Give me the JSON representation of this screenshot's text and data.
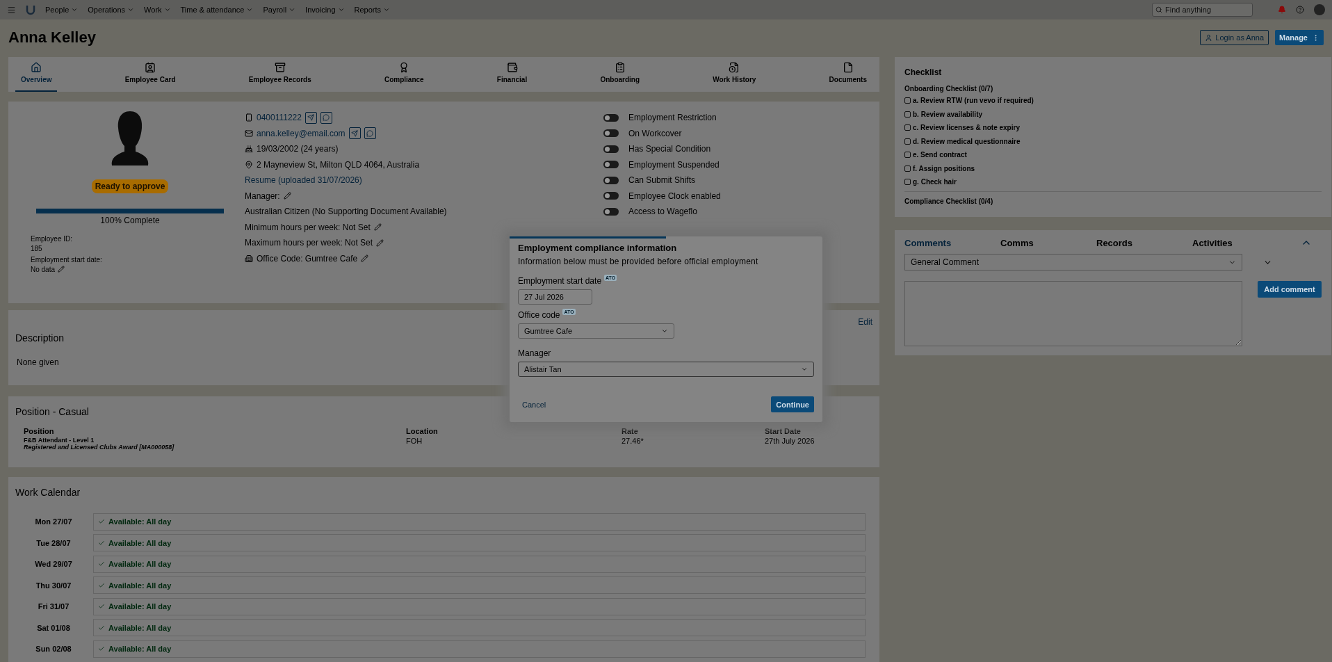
{
  "nav": {
    "items": [
      "People",
      "Operations",
      "Work",
      "Time & attendance",
      "Payroll",
      "Invoicing",
      "Reports"
    ],
    "search_placeholder": "Find anything"
  },
  "header": {
    "title": "Anna Kelley",
    "login_button": "Login as Anna",
    "manage_button": "Manage"
  },
  "tabs": [
    {
      "label": "Overview",
      "selected": true
    },
    {
      "label": "Employee Card",
      "selected": false
    },
    {
      "label": "Employee Records",
      "selected": false
    },
    {
      "label": "Compliance",
      "selected": false
    },
    {
      "label": "Financial",
      "selected": false
    },
    {
      "label": "Onboarding",
      "selected": false
    },
    {
      "label": "Work History",
      "selected": false
    },
    {
      "label": "Documents",
      "selected": false
    }
  ],
  "profile": {
    "status_badge": "Ready to approve",
    "progress": {
      "level": 1
    },
    "progress_label": "100% Complete",
    "fields": [
      {
        "label": "Employee ID:",
        "value": "185",
        "editable": false
      },
      {
        "label": "Employment start date:",
        "value": "No data",
        "editable": true
      }
    ]
  },
  "details": [
    {
      "kind": "phone",
      "text": "0400111222"
    },
    {
      "kind": "email",
      "text": "anna.kelley@email.com"
    },
    {
      "kind": "birthday",
      "text": "19/03/2002 (24 years)"
    },
    {
      "kind": "address",
      "text": "2 Mayneview St, Milton QLD 4064, Australia"
    },
    {
      "kind": "link",
      "text": "Resume (uploaded 31/07/2026)"
    },
    {
      "kind": "editable",
      "text": "Manager:"
    },
    {
      "kind": "plain",
      "text": "Australian Citizen (No Supporting Document Available)"
    },
    {
      "kind": "editable",
      "text": "Minimum hours per week: Not Set"
    },
    {
      "kind": "editable",
      "text": "Maximum hours per week: Not Set"
    },
    {
      "kind": "office",
      "text": "Office Code: Gumtree Cafe"
    }
  ],
  "toggles": [
    {
      "label": "Employment Restriction",
      "on": false
    },
    {
      "label": "On Workcover",
      "on": false
    },
    {
      "label": "Has Special Condition",
      "on": false
    },
    {
      "label": "Employment Suspended",
      "on": false
    },
    {
      "label": "Can Submit Shifts",
      "on": false
    },
    {
      "label": "Employee Clock enabled",
      "on": false
    },
    {
      "label": "Access to Wageflo",
      "on": false
    }
  ],
  "description": {
    "title": "Description",
    "edit": "Edit",
    "text": "None given"
  },
  "position": {
    "title": "Position - Casual",
    "columns": [
      "Position",
      "Location",
      "Rate",
      "Start Date"
    ],
    "row": {
      "position": "F&B Attendant - Level 1",
      "award": "Registered and Licensed Clubs Award [MA000058]",
      "location": "FOH",
      "rate": "27.46*",
      "start_date": "27th July 2026"
    }
  },
  "calendar": {
    "title": "Work Calendar",
    "days": [
      {
        "day": "Mon 27/07",
        "status": "Available: All day"
      },
      {
        "day": "Tue 28/07",
        "status": "Available: All day"
      },
      {
        "day": "Wed 29/07",
        "status": "Available: All day"
      },
      {
        "day": "Thu 30/07",
        "status": "Available: All day"
      },
      {
        "day": "Fri 31/07",
        "status": "Available: All day"
      },
      {
        "day": "Sat 01/08",
        "status": "Available: All day"
      },
      {
        "day": "Sun 02/08",
        "status": "Available: All day"
      }
    ]
  },
  "checklist": {
    "title": "Checklist",
    "onboarding_title": "Onboarding Checklist (0/7)",
    "items": [
      {
        "label": "a. Review RTW (run vevo if required)",
        "checked": false
      },
      {
        "label": "b. Review availability",
        "checked": false
      },
      {
        "label": "c. Review licenses & note expiry",
        "checked": false
      },
      {
        "label": "d. Review medical questionnaire",
        "checked": false
      },
      {
        "label": "e. Send contract",
        "checked": false
      },
      {
        "label": "f. Assign positions",
        "checked": false
      },
      {
        "label": "g. Check hair",
        "checked": false
      }
    ],
    "compliance_title": "Compliance Checklist (0/4)"
  },
  "comments": {
    "tabs": [
      {
        "label": "Comments",
        "selected": true
      },
      {
        "label": "Comms",
        "selected": false
      },
      {
        "label": "Records",
        "selected": false
      },
      {
        "label": "Activities",
        "selected": false
      }
    ],
    "type_select": "General Comment",
    "add_button": "Add comment"
  },
  "modal": {
    "progress": {
      "level": 0.5
    },
    "title": "Employment compliance information",
    "subtitle": "Information below must be provided before official employment",
    "fields": [
      {
        "label": "Employment start date",
        "badge": "ATO",
        "kind": "date",
        "value": "27 Jul 2026"
      },
      {
        "label": "Office code",
        "badge": "ATO",
        "kind": "select",
        "value": "Gumtree Cafe"
      },
      {
        "label": "Manager",
        "kind": "wide_select",
        "value": "Alistair Tan"
      }
    ],
    "cancel": "Cancel",
    "continue": "Continue"
  }
}
